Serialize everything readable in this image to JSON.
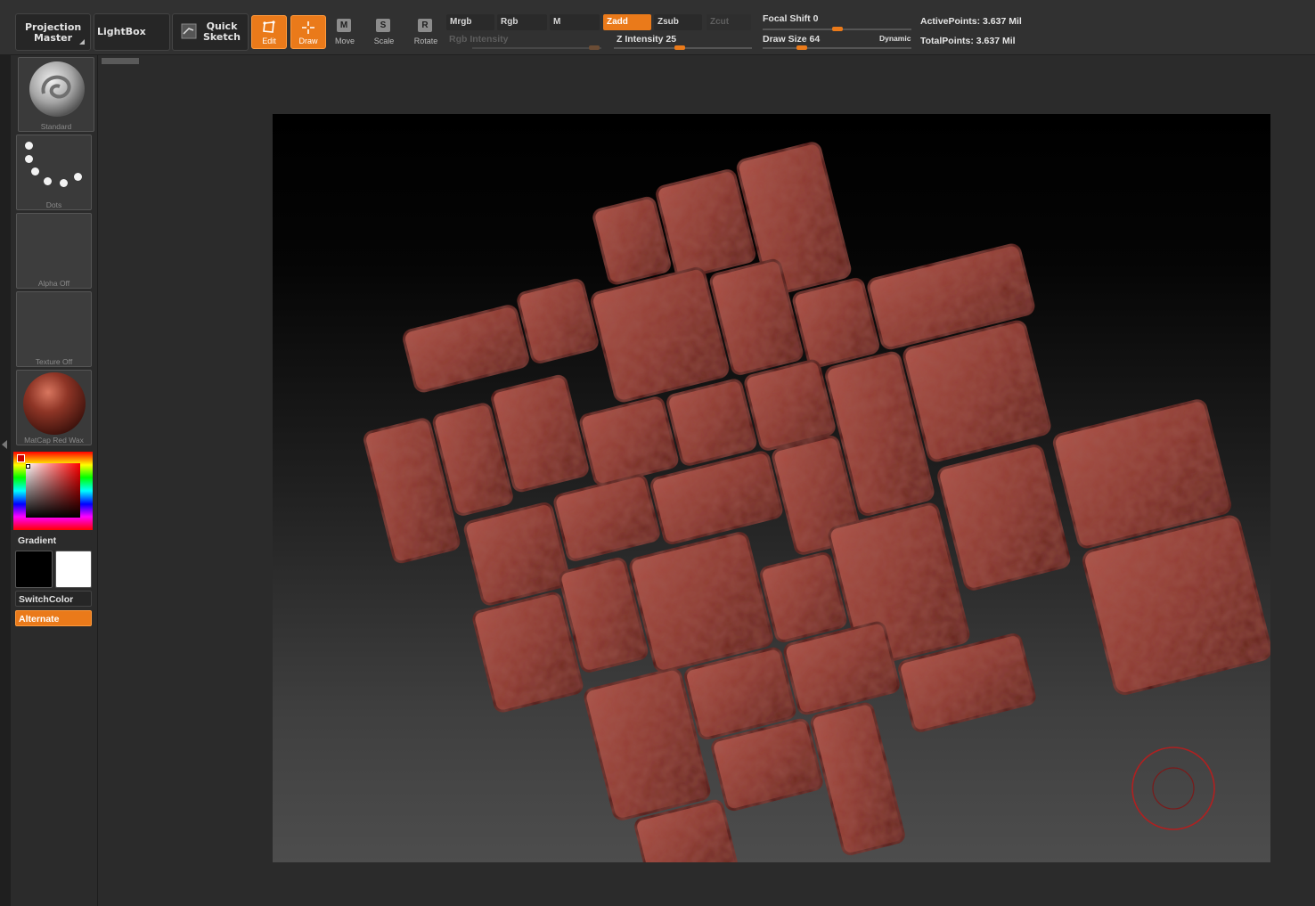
{
  "toolbar": {
    "projection_master": "Projection Master",
    "lightbox": "LightBox",
    "quick_sketch": "Quick Sketch",
    "edit": "Edit",
    "draw": "Draw",
    "move": "Move",
    "scale": "Scale",
    "rotate": "Rotate",
    "move_key": "M",
    "scale_key": "S",
    "rotate_key": "R"
  },
  "modes": {
    "mrgb": "Mrgb",
    "rgb": "Rgb",
    "m": "M",
    "zadd": "Zadd",
    "zsub": "Zsub",
    "zcut": "Zcut",
    "rgb_intensity": "Rgb Intensity",
    "z_intensity": "Z Intensity 25"
  },
  "brush_settings": {
    "focal_shift": "Focal Shift 0",
    "draw_size": "Draw Size 64",
    "dynamic": "Dynamic",
    "z_intensity_value": 25,
    "draw_size_value": 64
  },
  "stats": {
    "active_points": "ActivePoints: 3.637 Mil",
    "total_points": "TotalPoints: 3.637 Mil"
  },
  "palette": {
    "brush_label": "Standard",
    "stroke_label": "Dots",
    "alpha_label": "Alpha Off",
    "texture_label": "Texture Off",
    "material_label": "MatCap Red Wax",
    "gradient": "Gradient",
    "switch_color": "SwitchColor",
    "alternate": "Alternate"
  },
  "colors": {
    "accent": "#ea7a1a",
    "panel": "#313131",
    "material": "#8a3a30",
    "brush_cursor": "#b02020"
  }
}
